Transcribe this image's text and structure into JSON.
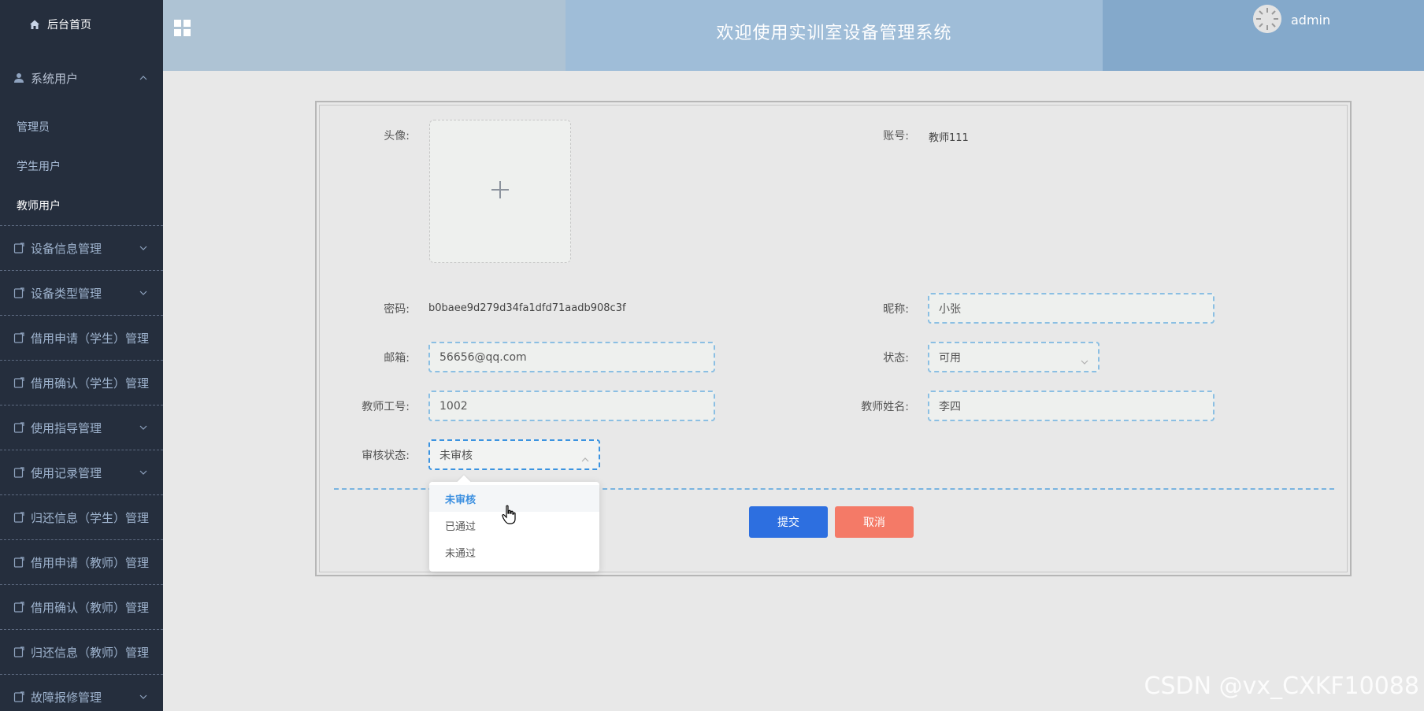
{
  "sidebar": {
    "home": "后台首页",
    "system_users": {
      "label": "系统用户",
      "children": [
        "管理员",
        "学生用户",
        "教师用户"
      ],
      "active": "教师用户"
    },
    "items": [
      "设备信息管理",
      "设备类型管理",
      "借用申请（学生）管理",
      "借用确认（学生）管理",
      "使用指导管理",
      "使用记录管理",
      "归还信息（学生）管理",
      "借用申请（教师）管理",
      "借用确认（教师）管理",
      "归还信息（教师）管理",
      "故障报修管理"
    ]
  },
  "header": {
    "title": "欢迎使用实训室设备管理系统",
    "username": "admin"
  },
  "form": {
    "avatar_label": "头像:",
    "account_label": "账号:",
    "account_value": "教师111",
    "password_label": "密码:",
    "password_value": "b0baee9d279d34fa1dfd71aadb908c3f",
    "nickname_label": "昵称:",
    "nickname_value": "小张",
    "email_label": "邮箱:",
    "email_value": "56656@qq.com",
    "status_label": "状态:",
    "status_value": "可用",
    "teacher_no_label": "教师工号:",
    "teacher_no_value": "1002",
    "teacher_name_label": "教师姓名:",
    "teacher_name_value": "李四",
    "review_label": "审核状态:",
    "review_value": "未审核",
    "review_options": [
      "未审核",
      "已通过",
      "未通过"
    ],
    "submit": "提交",
    "cancel": "取消"
  },
  "watermark": "CSDN @vx_CXKF10088",
  "colors": {
    "sidebar_bg": "#252e3d",
    "submit": "#2d6fe0",
    "cancel": "#f47a67",
    "accent": "#3b8fe0"
  }
}
